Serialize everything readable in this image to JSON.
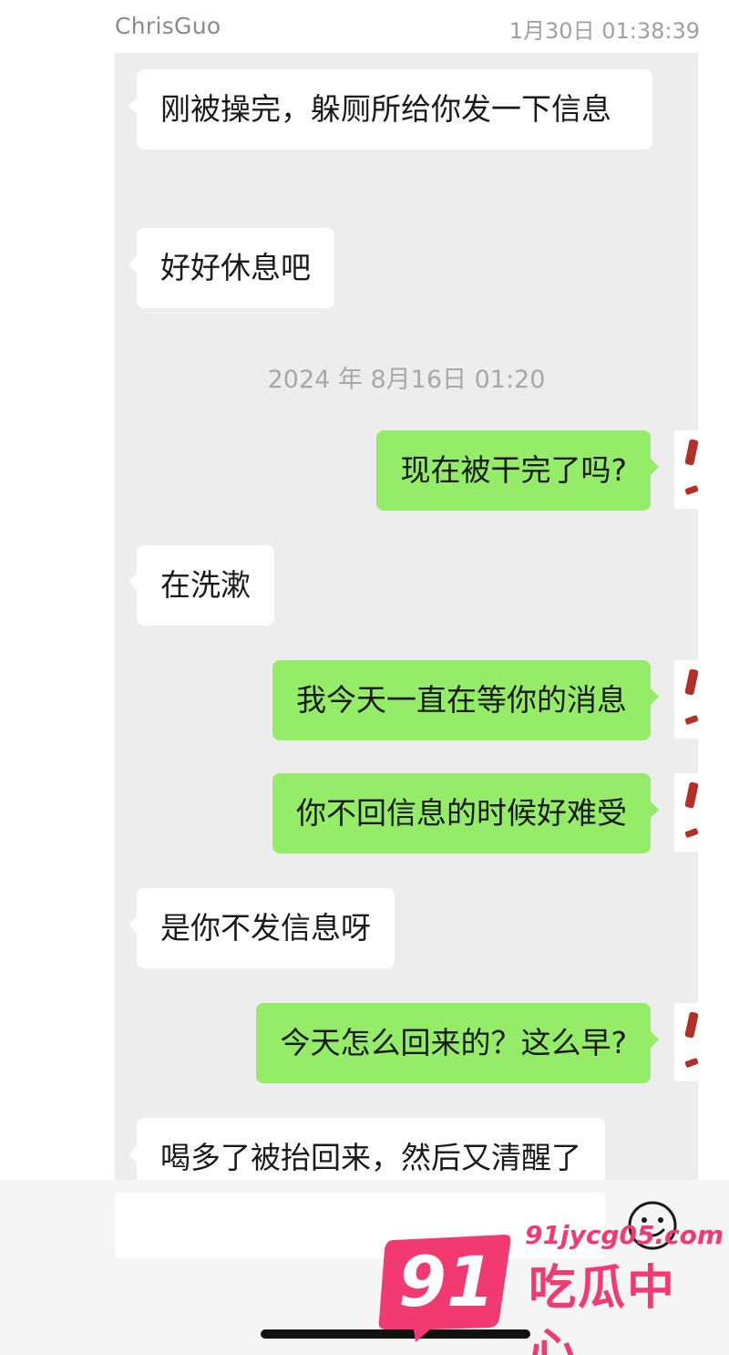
{
  "header": {
    "sender": "ChrisGuo",
    "time": "1月30日 01:38:39"
  },
  "messages": [
    {
      "side": "in",
      "text": "刚被操完，躲厕所给你发一下信息"
    },
    {
      "side": "in",
      "text": "好好休息吧"
    },
    {
      "type": "timestamp",
      "text": "2024 年 8月16日 01:20"
    },
    {
      "side": "out",
      "text": "现在被干完了吗?"
    },
    {
      "side": "in",
      "text": "在洗漱"
    },
    {
      "side": "out",
      "text": "我今天一直在等你的消息"
    },
    {
      "side": "out",
      "text": "你不回信息的时候好难受"
    },
    {
      "side": "in",
      "text": "是你不发信息呀"
    },
    {
      "side": "out",
      "text": "今天怎么回来的？这么早?"
    },
    {
      "side": "in",
      "text": "喝多了被抬回来，然后又清醒了"
    }
  ],
  "input_bar": {
    "emoji_icon": "smiley-face-icon"
  },
  "watermark": {
    "number": "91",
    "site": "91jycg05.com",
    "name": "吃瓜中心"
  },
  "colors": {
    "outgoing_bubble": "#95ec69",
    "incoming_bubble": "#ffffff",
    "chat_background": "#ededed",
    "watermark": "#f23a72"
  }
}
